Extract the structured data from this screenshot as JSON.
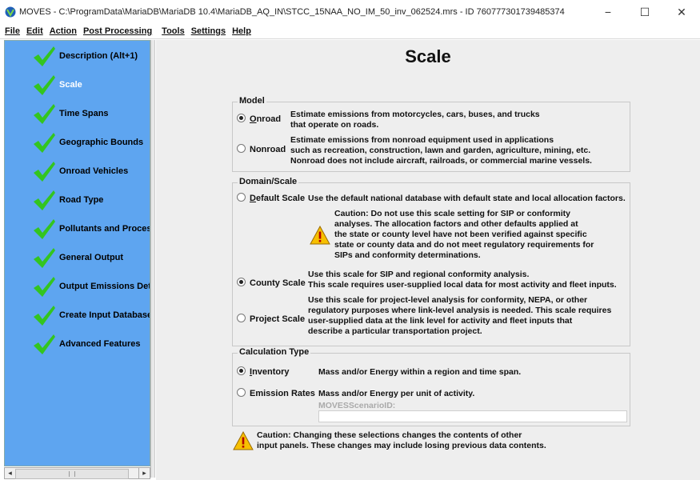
{
  "window": {
    "title": "MOVES - C:\\ProgramData\\MariaDB\\MariaDB 10.4\\MariaDB_AQ_IN\\STCC_15NAA_NO_IM_50_inv_062524.mrs - ID 760777301739485374",
    "minimize": "−",
    "maximize": "☐",
    "close": "✕"
  },
  "menu": [
    "File",
    "Edit",
    "Action",
    "Post Processing",
    "Tools",
    "Settings",
    "Help"
  ],
  "sidebar": {
    "items": [
      {
        "label": "Description (Alt+1)",
        "selected": false
      },
      {
        "label": "Scale",
        "selected": true
      },
      {
        "label": "Time Spans",
        "selected": false
      },
      {
        "label": "Geographic Bounds",
        "selected": false
      },
      {
        "label": "Onroad Vehicles",
        "selected": false
      },
      {
        "label": "Road Type",
        "selected": false
      },
      {
        "label": "Pollutants and Proces",
        "selected": false
      },
      {
        "label": "General Output",
        "selected": false
      },
      {
        "label": "Output Emissions Det",
        "selected": false
      },
      {
        "label": "Create Input Database",
        "selected": false
      },
      {
        "label": "Advanced Features",
        "selected": false
      }
    ],
    "scroll_left": "◂",
    "scroll_right": "▸"
  },
  "main": {
    "title": "Scale",
    "model": {
      "legend": "Model",
      "onroad_label": "Onroad",
      "onroad_line1": "Estimate emissions from motorcycles, cars, buses, and trucks",
      "onroad_line2": "that operate on roads.",
      "nonroad_label": "Nonroad",
      "nonroad_line1": "Estimate emissions from nonroad equipment used in applications",
      "nonroad_line2": "such as recreation, construction, lawn and garden, agriculture, mining, etc.",
      "nonroad_line3": "Nonroad does not include aircraft, railroads, or commercial marine vessels.",
      "selected": "onroad"
    },
    "domain": {
      "legend": "Domain/Scale",
      "default_label": "Default Scale",
      "default_desc": "Use the default national database with default state and local allocation factors.",
      "caution_line1": "Caution: Do not use this scale setting for SIP or conformity",
      "caution_line2": "analyses. The allocation factors and other defaults applied at",
      "caution_line3": "the state or county level have not been verified against specific",
      "caution_line4": "state or county data and do not meet regulatory requirements for",
      "caution_line5": "SIPs and conformity determinations.",
      "county_label": "County Scale",
      "county_line1": "Use this scale for SIP and regional conformity analysis.",
      "county_line2": "This scale requires user-supplied local data for most activity and fleet inputs.",
      "project_label": "Project Scale",
      "project_line1": "Use this scale for project-level analysis for conformity, NEPA, or other",
      "project_line2": "regulatory purposes where link-level analysis is needed. This scale requires",
      "project_line3": "user-supplied data at the link level for activity and fleet inputs that",
      "project_line4": "describe a particular transportation project.",
      "selected": "county"
    },
    "calc": {
      "legend": "Calculation Type",
      "inventory_label": "Inventory",
      "inventory_desc": "Mass and/or Energy within a region and time span.",
      "rates_label": "Emission Rates",
      "rates_desc": "Mass and/or Energy per unit of activity.",
      "scenario_label": "MOVESScenarioID:",
      "scenario_value": "",
      "selected": "inventory"
    },
    "bottom_caution_line1": "Caution: Changing these selections changes the contents of other",
    "bottom_caution_line2": "input panels. These changes may include losing previous data contents."
  },
  "colors": {
    "sidebar_bg": "#5ea5f0",
    "panel_bg": "#eeeeee",
    "check_green": "#33c51f",
    "warning_yellow": "#f7c000"
  }
}
